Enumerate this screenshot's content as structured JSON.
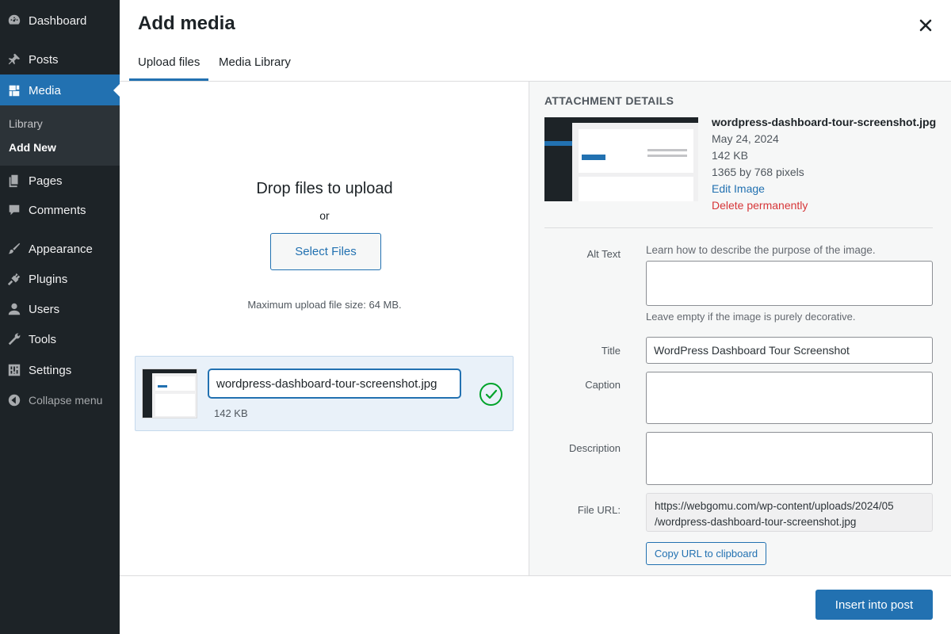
{
  "sidebar": {
    "items": [
      {
        "label": "Dashboard",
        "icon": "dashboard-icon"
      },
      {
        "label": "Posts",
        "icon": "pin-icon"
      },
      {
        "label": "Media",
        "icon": "media-icon"
      },
      {
        "label": "Pages",
        "icon": "pages-icon"
      },
      {
        "label": "Comments",
        "icon": "comment-icon"
      },
      {
        "label": "Appearance",
        "icon": "brush-icon"
      },
      {
        "label": "Plugins",
        "icon": "plugin-icon"
      },
      {
        "label": "Users",
        "icon": "user-icon"
      },
      {
        "label": "Tools",
        "icon": "wrench-icon"
      },
      {
        "label": "Settings",
        "icon": "settings-icon"
      }
    ],
    "submenu": [
      {
        "label": "Library"
      },
      {
        "label": "Add New"
      }
    ],
    "collapse_label": "Collapse menu"
  },
  "modal": {
    "title": "Add media",
    "tabs": [
      {
        "label": "Upload files",
        "active": true
      },
      {
        "label": "Media Library",
        "active": false
      }
    ]
  },
  "upload": {
    "drop_text": "Drop files to upload",
    "or_text": "or",
    "select_button": "Select Files",
    "max_size_text": "Maximum upload file size: 64 MB.",
    "file": {
      "name": "wordpress-dashboard-tour-screenshot.jpg",
      "size": "142 KB",
      "status": "uploaded"
    }
  },
  "attachment": {
    "header": "ATTACHMENT DETAILS",
    "filename": "wordpress-dashboard-tour-screenshot.jpg",
    "date": "May 24, 2024",
    "size": "142 KB",
    "dimensions": "1365 by 768 pixels",
    "edit_link": "Edit Image",
    "delete_link": "Delete permanently",
    "alt_text_label": "Alt Text",
    "alt_text_link": "Learn how to describe the purpose of the image.",
    "alt_text_value": "",
    "alt_text_help": "Leave empty if the image is purely decorative.",
    "title_label": "Title",
    "title_value": "WordPress Dashboard Tour Screenshot",
    "caption_label": "Caption",
    "caption_value": "",
    "description_label": "Description",
    "description_value": "",
    "file_url_label": "File URL:",
    "file_url_line1": "https://webgomu.com/wp-content/uploads/2024/05",
    "file_url_line2": "/wordpress-dashboard-tour-screenshot.jpg",
    "copy_button": "Copy URL to clipboard"
  },
  "footer": {
    "insert_button": "Insert into post"
  },
  "colors": {
    "sidebar_bg": "#1d2327",
    "accent": "#2271b1",
    "success": "#00a32a",
    "danger": "#d63638",
    "panel_bg": "#f6f7f7"
  }
}
